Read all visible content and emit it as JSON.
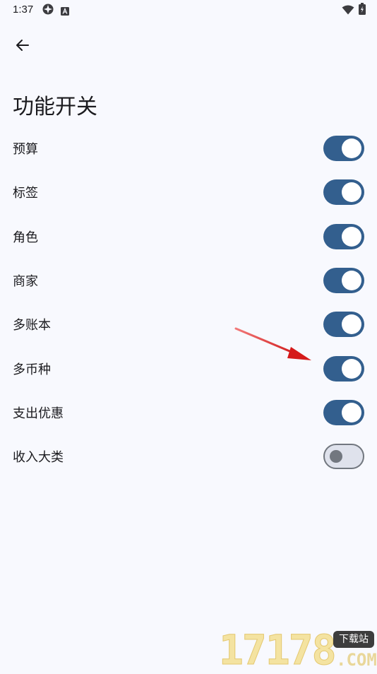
{
  "status_bar": {
    "time": "1:37",
    "icons": [
      "app-notification-icon",
      "keyboard-a-icon",
      "wifi-icon",
      "battery-charging-icon"
    ]
  },
  "header": {
    "back_icon": "arrow-left-icon",
    "title": "功能开关"
  },
  "settings": [
    {
      "label": "预算",
      "enabled": true
    },
    {
      "label": "标签",
      "enabled": true
    },
    {
      "label": "角色",
      "enabled": true
    },
    {
      "label": "商家",
      "enabled": true
    },
    {
      "label": "多账本",
      "enabled": true
    },
    {
      "label": "多币种",
      "enabled": true
    },
    {
      "label": "支出优惠",
      "enabled": true
    },
    {
      "label": "收入大类",
      "enabled": false
    }
  ],
  "annotation": {
    "arrow_color": "#e02020",
    "points_to": "多币种"
  },
  "watermark": {
    "digits": "17178",
    "badge": "下载站",
    "suffix": ".COM"
  },
  "colors": {
    "background": "#f8f9fe",
    "switch_on_track": "#335f8e",
    "switch_off_track": "#dfe2ec",
    "switch_off_outline": "#72777f",
    "text": "#1b1b1f"
  }
}
